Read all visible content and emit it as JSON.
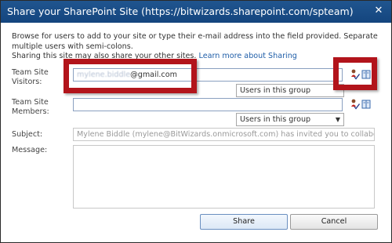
{
  "window": {
    "title": "Share your SharePoint Site (https://bitwizards.sharepoint.com/spteam)",
    "close_symbol": "✕"
  },
  "instructions": {
    "line1": "Browse for users to add to your site or type their e-mail address into the field provided. Separate multiple users with semi-colons.",
    "line2": "Sharing this site may also share your other sites.",
    "link": "Learn more about Sharing"
  },
  "visitors": {
    "label_line1": "Team Site",
    "label_line2": "Visitors:",
    "value_blurred": "mylene.biddle",
    "value_suffix": "@gmail.com",
    "group_select": "Users in this group"
  },
  "members": {
    "label_line1": "Team Site",
    "label_line2": "Members:",
    "value": "",
    "group_select": "Users in this group"
  },
  "subject": {
    "label": "Subject:",
    "value": "Mylene Biddle (mylene@BitWizards.onmicrosoft.com) has invited you to collaborate on SP Te"
  },
  "message": {
    "label": "Message:",
    "value": ""
  },
  "buttons": {
    "share": "Share",
    "cancel": "Cancel"
  },
  "icons": {
    "check_names": "person-check-icon",
    "browse": "address-book-icon"
  },
  "colors": {
    "titlebar": "#1a4f8a",
    "highlight": "#b2141b",
    "link": "#1f5ea8"
  }
}
